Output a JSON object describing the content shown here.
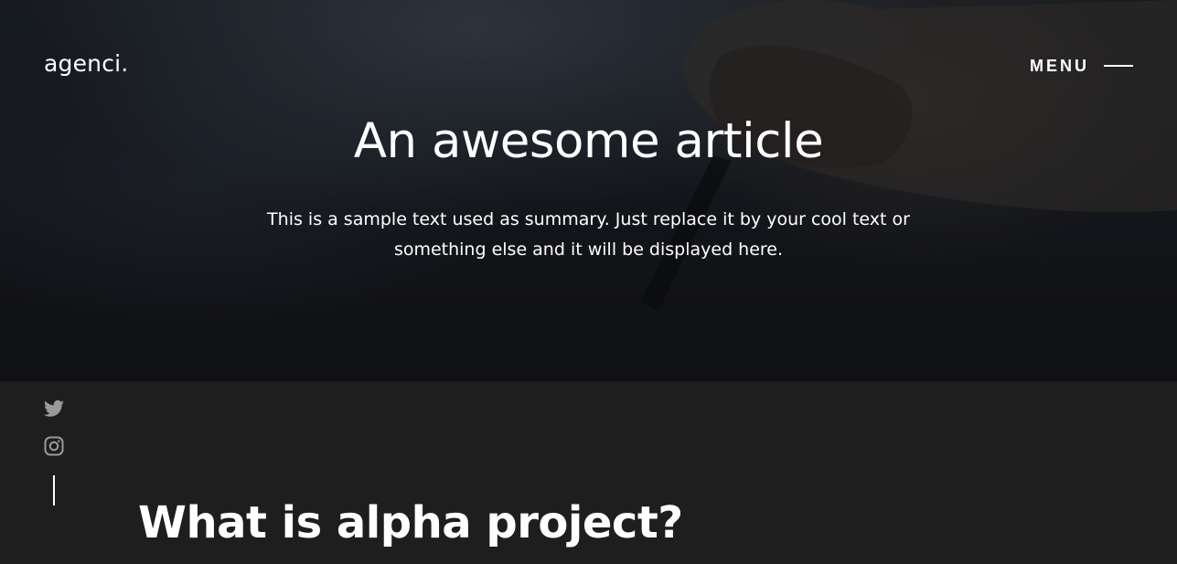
{
  "header": {
    "logo": "agenci.",
    "menu_label": "MENU",
    "menu_icon": "hamburger-line-icon"
  },
  "hero": {
    "title": "An awesome article",
    "summary": "This is a sample text used as summary. Just replace it by your cool text or something else and it will be displayed here."
  },
  "social": {
    "items": [
      {
        "icon": "twitter-icon"
      },
      {
        "icon": "instagram-icon"
      }
    ]
  },
  "article": {
    "heading": "What is alpha project?"
  },
  "colors": {
    "text": "#ffffff",
    "content_bg": "#1e1e1e",
    "social_icon": "#9a9a9a"
  }
}
